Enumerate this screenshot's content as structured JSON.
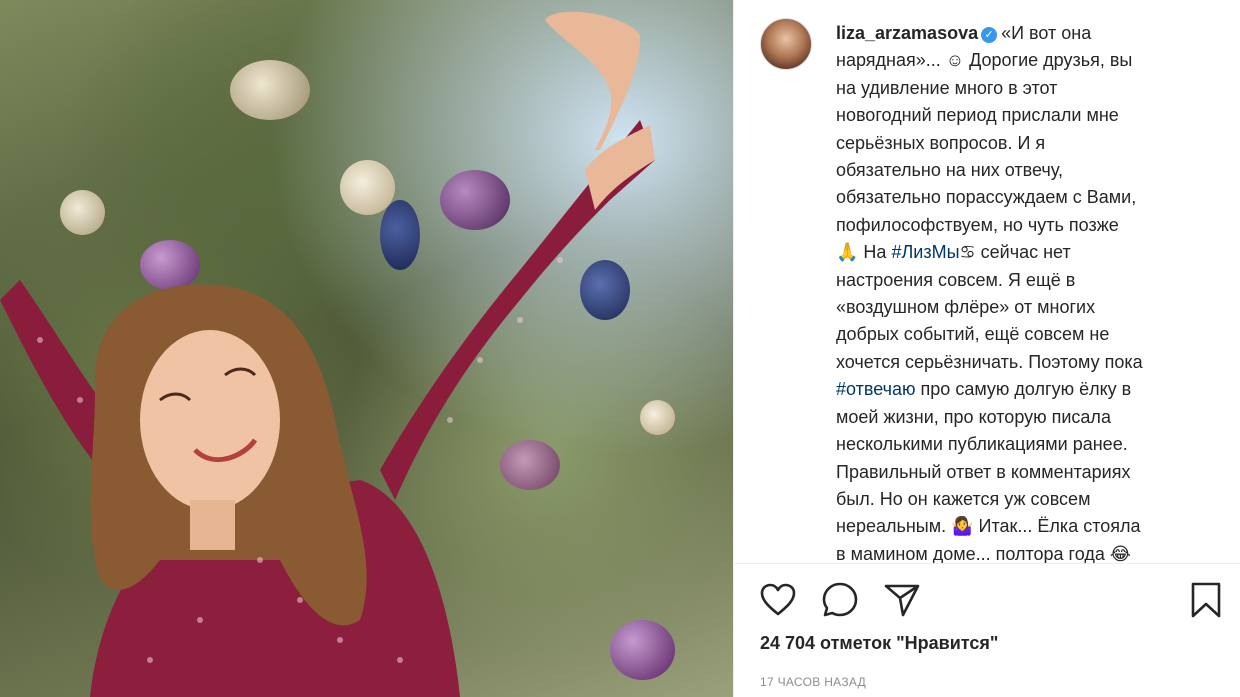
{
  "post": {
    "username": "liza_arzamasova",
    "caption_lines": [
      "«И вот она",
      "нарядная»... ☺ Дорогие друзья, вы",
      "на удивление много в этот",
      "новогодний период прислали мне",
      "серьёзных вопросов. И я",
      "обязательно на них отвечу,",
      "обязательно порассуждаем с Вами,",
      "пофилософствуем, но чуть позже",
      "🙏 На ",
      " сейчас нет",
      "настроения совсем. Я ещё в",
      "«воздушном флёре» от многих",
      "добрых событий, ещё совсем не",
      "хочется серьёзничать. Поэтому пока",
      " про самую долгую ёлку в",
      "моей жизни, про которую писала",
      "несколькими публикациями ранее.",
      "Правильный ответ в комментариях",
      "был. Но он кажется уж совсем",
      "нереальным. 🤷‍♀️ Итак... Ёлка стояла",
      "в мамином доме... полтора года 😂"
    ],
    "hashtags": [
      "#ЛизМы",
      "#отвечаю"
    ],
    "hashtag_emoji": "♋",
    "likes": "24 704 отметок \"Нравится\"",
    "timestamp": "17 ЧАСОВ НАЗАД"
  },
  "icons": [
    "heart-icon",
    "comment-icon",
    "share-icon",
    "bookmark-icon",
    "verified-icon"
  ],
  "colors": {
    "text": "#262626",
    "hashtag": "#00376b",
    "meta": "#8e8e8e",
    "verified": "#3897f0"
  }
}
